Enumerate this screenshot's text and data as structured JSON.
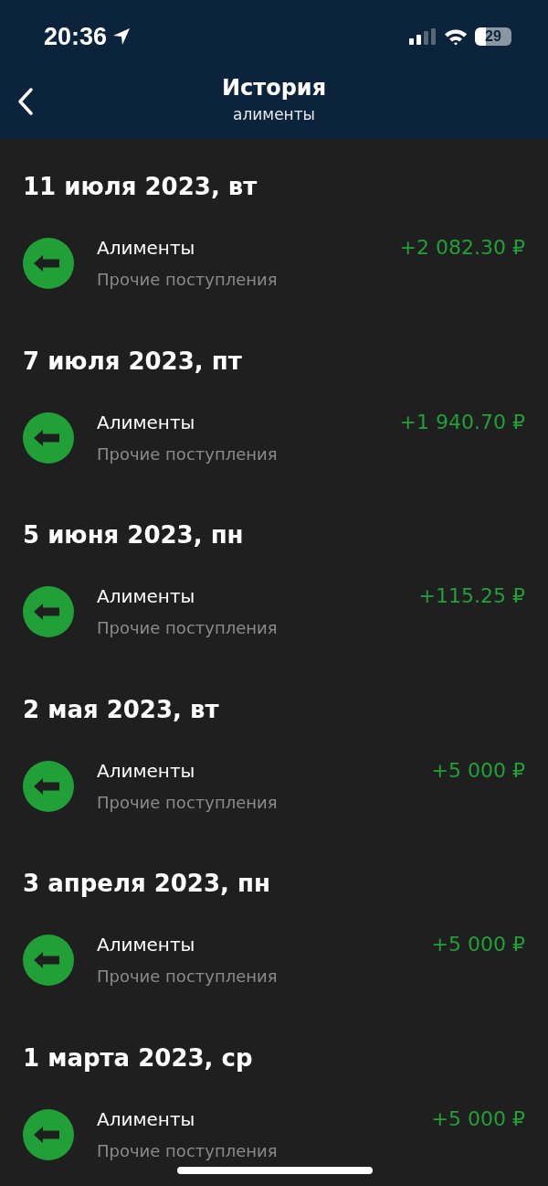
{
  "status_bar": {
    "time": "20:36",
    "battery": "29"
  },
  "header": {
    "title": "История",
    "subtitle": "алименты"
  },
  "days": [
    {
      "date": "11 июля 2023, вт",
      "items": [
        {
          "name": "Алименты",
          "category": "Прочие поступления",
          "amount": "+2 082.30 ₽"
        }
      ]
    },
    {
      "date": "7 июля 2023, пт",
      "items": [
        {
          "name": "Алименты",
          "category": "Прочие поступления",
          "amount": "+1 940.70 ₽"
        }
      ]
    },
    {
      "date": "5 июня 2023, пн",
      "items": [
        {
          "name": "Алименты",
          "category": "Прочие поступления",
          "amount": "+115.25 ₽"
        }
      ]
    },
    {
      "date": "2 мая 2023, вт",
      "items": [
        {
          "name": "Алименты",
          "category": "Прочие поступления",
          "amount": "+5 000 ₽"
        }
      ]
    },
    {
      "date": "3 апреля 2023, пн",
      "items": [
        {
          "name": "Алименты",
          "category": "Прочие поступления",
          "amount": "+5 000 ₽"
        }
      ]
    },
    {
      "date": "1 марта 2023, ср",
      "items": [
        {
          "name": "Алименты",
          "category": "Прочие поступления",
          "amount": "+5 000 ₽"
        }
      ]
    }
  ]
}
